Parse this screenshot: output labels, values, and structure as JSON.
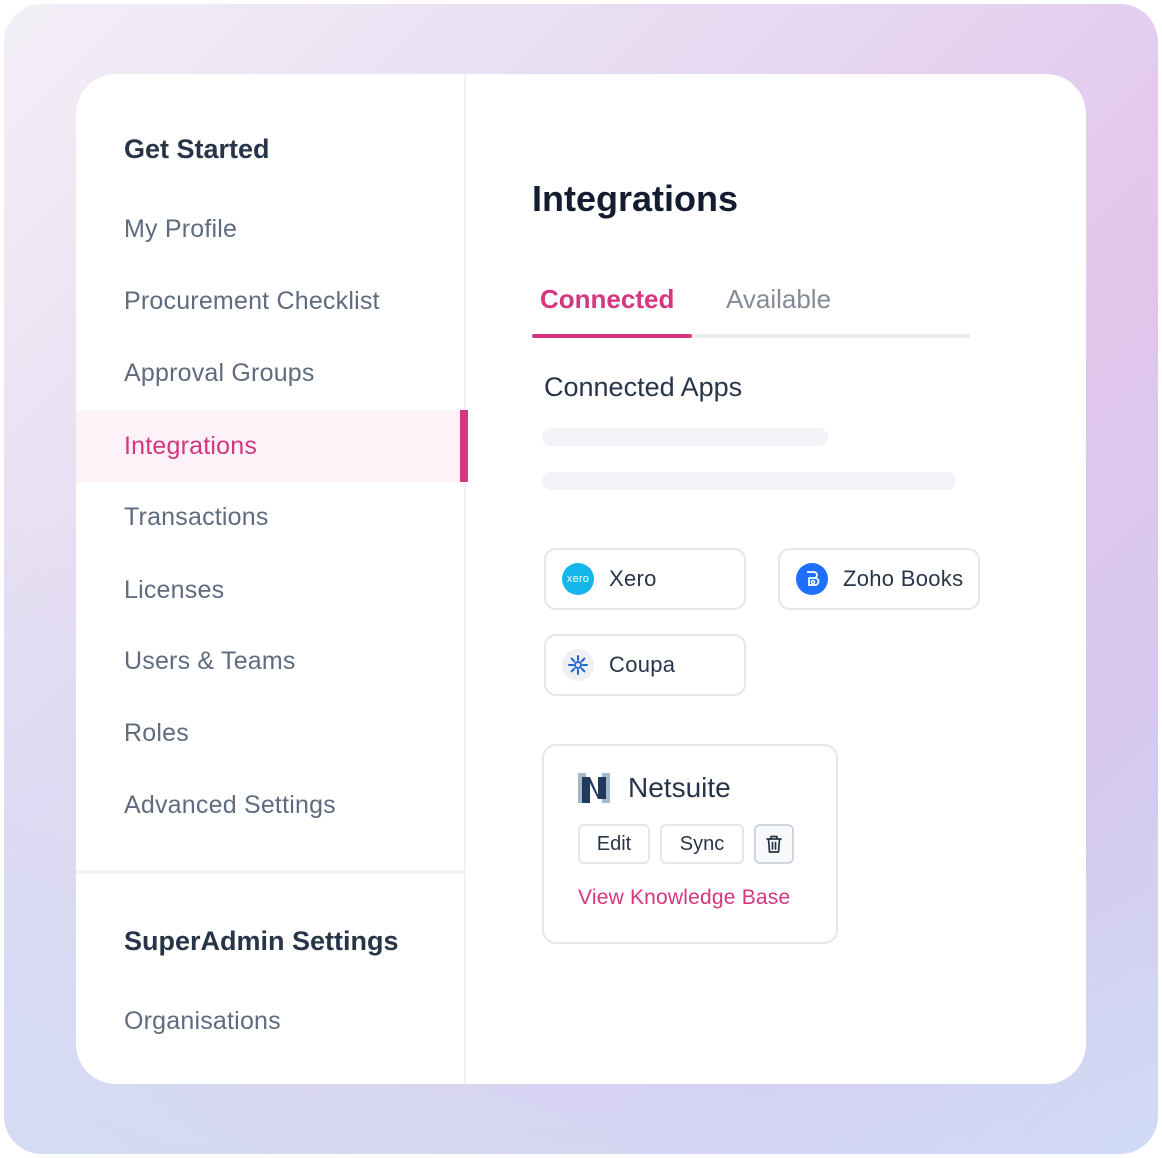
{
  "sidebar": {
    "get_started_title": "Get Started",
    "items": [
      {
        "label": "My Profile"
      },
      {
        "label": "Procurement Checklist"
      },
      {
        "label": "Approval Groups"
      },
      {
        "label": "Integrations",
        "active": true
      },
      {
        "label": "Transactions"
      },
      {
        "label": "Licenses"
      },
      {
        "label": "Users & Teams"
      },
      {
        "label": "Roles"
      },
      {
        "label": "Advanced Settings"
      }
    ],
    "superadmin_title": "SuperAdmin Settings",
    "superadmin_items": [
      {
        "label": "Organisations"
      }
    ]
  },
  "main": {
    "title": "Integrations",
    "tabs": [
      {
        "label": "Connected",
        "active": true
      },
      {
        "label": "Available",
        "active": false
      }
    ],
    "section_title": "Connected Apps",
    "apps": [
      {
        "name": "Xero",
        "icon": "xero-logo-icon",
        "logo_text": "xero",
        "color": "#13b5ea"
      },
      {
        "name": "Zoho Books",
        "icon": "zoho-books-logo-icon",
        "color": "#1e6fff"
      },
      {
        "name": "Coupa",
        "icon": "coupa-logo-icon",
        "color": "#1a64d6"
      }
    ],
    "netsuite": {
      "name": "Netsuite",
      "icon": "netsuite-logo-icon",
      "edit_label": "Edit",
      "sync_label": "Sync",
      "delete_icon": "trash-icon",
      "kb_link": "View Knowledge Base"
    }
  },
  "colors": {
    "accent": "#d6357f",
    "active_bg": "#fdf2f7",
    "text_dark": "#283548",
    "text_muted": "#5f6b7e"
  }
}
